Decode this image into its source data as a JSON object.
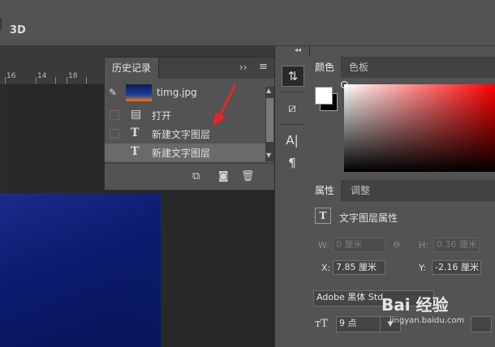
{
  "options_bar": {
    "btn_3d": "3D"
  },
  "ruler": {
    "ticks": [
      "16",
      "14",
      "16",
      "18"
    ]
  },
  "history_panel": {
    "tab": "历史记录",
    "more": "››",
    "menu": "≡",
    "snapshot": {
      "label": "timg.jpg"
    },
    "items": [
      {
        "icon": "document-icon",
        "label": "打开"
      },
      {
        "icon": "text-tool-icon",
        "label": "新建文字图层"
      },
      {
        "icon": "text-tool-icon",
        "label": "新建文字图层",
        "selected": true
      }
    ]
  },
  "color_panel": {
    "tabs": [
      "颜色",
      "色板"
    ],
    "foreground": "#ffffff",
    "background": "#000000"
  },
  "properties_panel": {
    "tabs": [
      "属性",
      "调整"
    ],
    "title": "文字图层属性",
    "w_label": "W:",
    "w_value": "0 厘米",
    "h_label": "H:",
    "h_value": "0.36 厘米",
    "x_label": "X:",
    "x_value": "7.85 厘米",
    "y_label": "Y:",
    "y_value": "-2.16 厘米",
    "font_family": "Adobe 黑体 Std",
    "font_size": "9 点"
  },
  "watermark": {
    "brand": "Bai 经验",
    "url": "jingyan.baidu.com"
  },
  "colors": {
    "accent_arrow": "#e8232a",
    "panel": "#535353",
    "dark": "#282828"
  }
}
